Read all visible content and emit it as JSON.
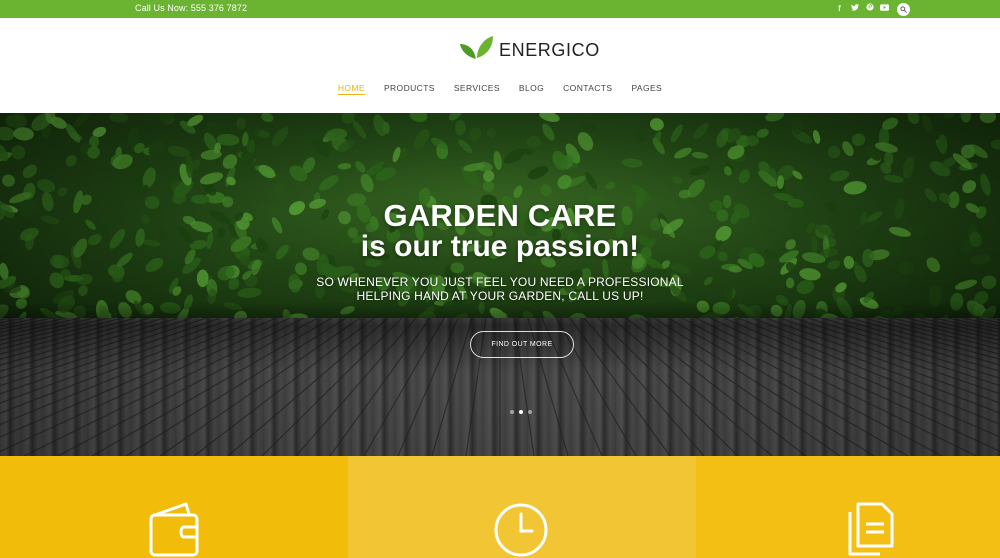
{
  "topbar": {
    "call_text": "Call Us Now: 555 376 7872",
    "socials": [
      {
        "icon": "facebook-icon",
        "glyph": "f"
      },
      {
        "icon": "twitter-icon",
        "glyph": "t"
      },
      {
        "icon": "pinterest-icon",
        "glyph": "p"
      },
      {
        "icon": "youtube-icon",
        "glyph": "▶"
      }
    ],
    "search_icon": "search-icon"
  },
  "header": {
    "brand": "ENERGICO",
    "nav": [
      "HOME",
      "PRODUCTS",
      "SERVICES",
      "BLOG",
      "CONTACTS",
      "PAGES"
    ],
    "active": "HOME"
  },
  "hero": {
    "title_line1": "GARDEN CARE",
    "title_line2": "is our true passion!",
    "subtitle_line1": "SO WHENEVER YOU JUST FEEL YOU NEED A PROFESSIONAL",
    "subtitle_line2": "HELPING HAND AT YOUR GARDEN, CALL US UP!",
    "cta_label": "FIND OUT MORE",
    "slides": 3,
    "active_slide": 2
  },
  "features": [
    {
      "icon": "wallet-icon"
    },
    {
      "icon": "clock-icon"
    },
    {
      "icon": "documents-icon"
    }
  ],
  "colors": {
    "topbar": "#6bb431",
    "active_nav": "#e4b51a",
    "feature_yellow": "#f1bc0a"
  }
}
